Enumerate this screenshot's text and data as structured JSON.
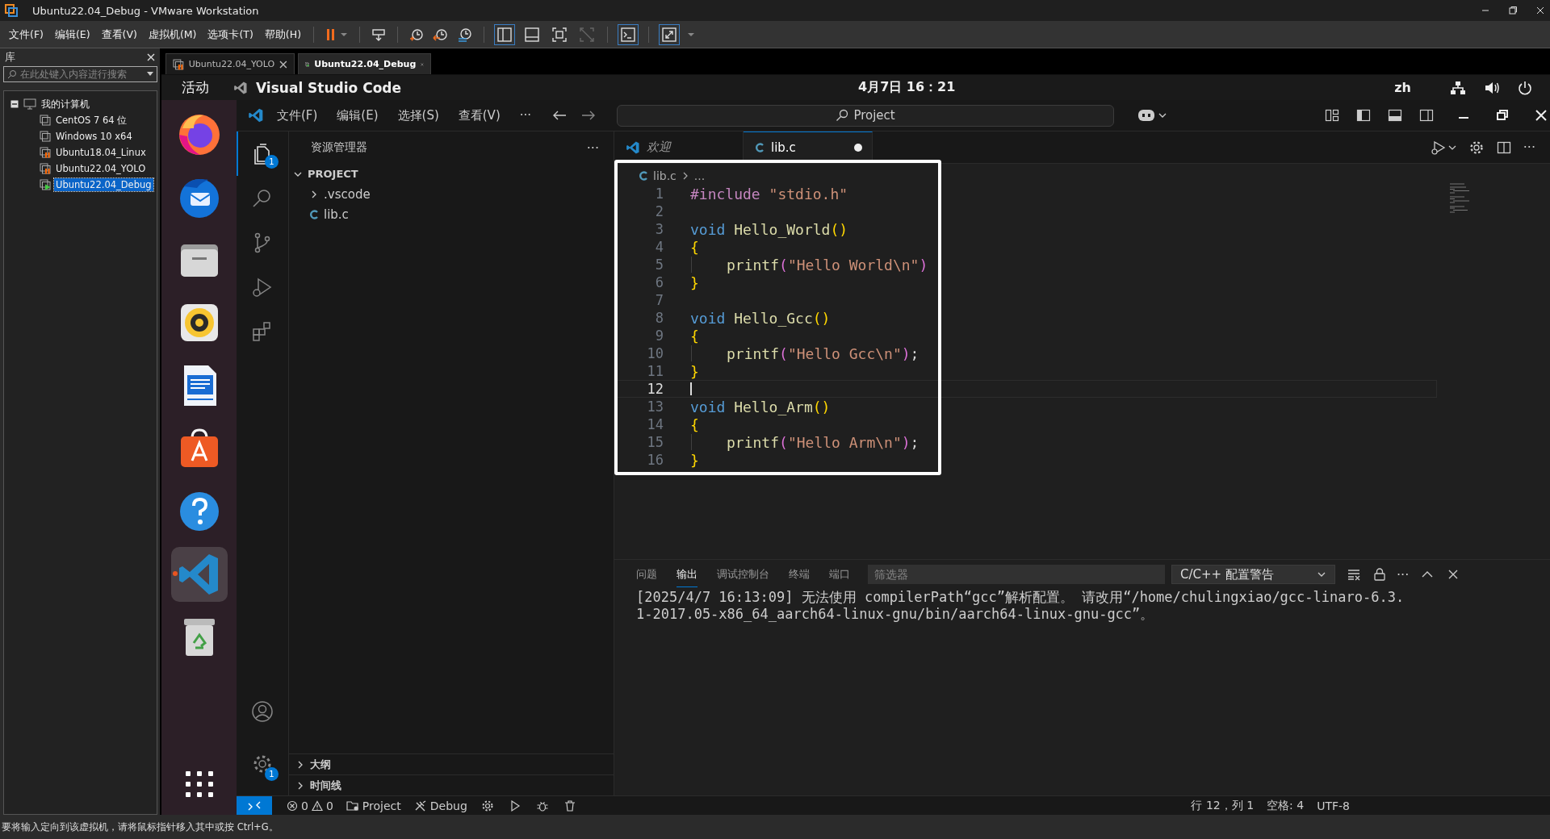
{
  "window": {
    "title": "Ubuntu22.04_Debug - VMware Workstation"
  },
  "menu": [
    "文件(F)",
    "编辑(E)",
    "查看(V)",
    "虚拟机(M)",
    "选项卡(T)",
    "帮助(H)"
  ],
  "library": {
    "title": "库",
    "search": {
      "placeholder": "在此处键入内容进行搜索"
    },
    "root": {
      "label": "我的计算机",
      "expanded": true,
      "children": [
        {
          "label": "CentOS 7 64 位",
          "kind": "off",
          "selected": false
        },
        {
          "label": "Windows 10 x64",
          "kind": "off",
          "selected": false
        },
        {
          "label": "Ubuntu18.04_Linux",
          "kind": "paused",
          "selected": false
        },
        {
          "label": "Ubuntu22.04_YOLO",
          "kind": "paused",
          "selected": false
        },
        {
          "label": "Ubuntu22.04_Debug",
          "kind": "running",
          "selected": true
        }
      ]
    }
  },
  "vm_tabs": [
    {
      "label": "Ubuntu22.04_YOLO",
      "kind": "paused",
      "selected": false
    },
    {
      "label": "Ubuntu22.04_Debug",
      "kind": "running",
      "selected": true
    }
  ],
  "guest_top_bar": {
    "activities": "活动",
    "app": "Visual Studio Code",
    "clock": "4月7日  16：21",
    "input_method": "zh"
  },
  "dock": [
    {
      "kind": "firefox",
      "selected": false
    },
    {
      "kind": "thunderbird",
      "selected": false
    },
    {
      "kind": "files",
      "selected": false
    },
    {
      "kind": "rhythmbox",
      "selected": false
    },
    {
      "kind": "writer",
      "selected": false
    },
    {
      "kind": "appcenter",
      "selected": false
    },
    {
      "kind": "help",
      "selected": false
    },
    {
      "kind": "vscode",
      "selected": true
    },
    {
      "kind": "trash",
      "selected": false
    }
  ],
  "vscode": {
    "menu": [
      "文件(F)",
      "编辑(E)",
      "选择(S)",
      "查看(V)",
      "···"
    ],
    "command_center": "Project",
    "activity_bar": [
      {
        "kind": "explorer",
        "selected": true,
        "badge": "1"
      },
      {
        "kind": "search",
        "selected": false
      },
      {
        "kind": "scm",
        "selected": false
      },
      {
        "kind": "debug",
        "selected": false
      },
      {
        "kind": "extensions",
        "selected": false
      }
    ],
    "manage_badge": "1",
    "sidebar": {
      "title": "资源管理器",
      "more": "···",
      "section": {
        "title": "PROJECT",
        "expanded": true,
        "items": [
          {
            "label": ".vscode",
            "kind": "folder",
            "expanded": false
          },
          {
            "label": "lib.c",
            "kind": "c"
          }
        ]
      },
      "collapsed_sections": [
        {
          "title": "大纲",
          "expanded": false
        },
        {
          "title": "时间线",
          "expanded": false
        }
      ]
    },
    "editor": {
      "tabs": [
        {
          "label": "欢迎",
          "kind": "welcome",
          "selected": false,
          "modified": false
        },
        {
          "label": "lib.c",
          "kind": "c",
          "selected": true,
          "modified": true
        }
      ],
      "breadcrumb": [
        "lib.c",
        "..."
      ],
      "lines": [
        {
          "n": "1",
          "current": false,
          "indent": false,
          "tokens": [
            {
              "t": "#include",
              "kind": "pre"
            },
            {
              "t": " \"stdio.h\"",
              "kind": "str"
            }
          ]
        },
        {
          "n": "2",
          "current": false,
          "indent": false
        },
        {
          "n": "3",
          "current": false,
          "indent": false,
          "tokens": [
            {
              "t": "void",
              "kind": "kw"
            },
            {
              "t": " Hello_World",
              "kind": "fn"
            },
            {
              "t": "()",
              "kind": "p1"
            }
          ]
        },
        {
          "n": "4",
          "current": false,
          "indent": false,
          "tokens": [
            {
              "t": "{",
              "kind": "p1"
            }
          ]
        },
        {
          "n": "5",
          "current": false,
          "indent": true,
          "tokens": [
            {
              "t": "printf",
              "kind": "fn"
            },
            {
              "t": "(",
              "kind": "p2"
            },
            {
              "t": "\"Hello World\\n\"",
              "kind": "str"
            },
            {
              "t": ")",
              "kind": "p2"
            }
          ]
        },
        {
          "n": "6",
          "current": false,
          "indent": false,
          "tokens": [
            {
              "t": "}",
              "kind": "p1"
            }
          ]
        },
        {
          "n": "7",
          "current": false,
          "indent": false
        },
        {
          "n": "8",
          "current": false,
          "indent": false,
          "tokens": [
            {
              "t": "void",
              "kind": "kw"
            },
            {
              "t": " Hello_Gcc",
              "kind": "fn"
            },
            {
              "t": "()",
              "kind": "p1"
            }
          ]
        },
        {
          "n": "9",
          "current": false,
          "indent": false,
          "tokens": [
            {
              "t": "{",
              "kind": "p1"
            }
          ]
        },
        {
          "n": "10",
          "current": false,
          "indent": true,
          "tokens": [
            {
              "t": "printf",
              "kind": "fn"
            },
            {
              "t": "(",
              "kind": "p2"
            },
            {
              "t": "\"Hello Gcc\\n\"",
              "kind": "str"
            },
            {
              "t": ")",
              "kind": "p2"
            },
            {
              "t": ";",
              "kind": "punct"
            }
          ]
        },
        {
          "n": "11",
          "current": false,
          "indent": false,
          "tokens": [
            {
              "t": "}",
              "kind": "p1"
            }
          ]
        },
        {
          "n": "12",
          "current": true,
          "indent": false
        },
        {
          "n": "13",
          "current": false,
          "indent": false,
          "tokens": [
            {
              "t": "void",
              "kind": "kw"
            },
            {
              "t": " Hello_Arm",
              "kind": "fn"
            },
            {
              "t": "()",
              "kind": "p1"
            }
          ]
        },
        {
          "n": "14",
          "current": false,
          "indent": false,
          "tokens": [
            {
              "t": "{",
              "kind": "p1"
            }
          ]
        },
        {
          "n": "15",
          "current": false,
          "indent": true,
          "tokens": [
            {
              "t": "printf",
              "kind": "fn"
            },
            {
              "t": "(",
              "kind": "p2"
            },
            {
              "t": "\"Hello Arm\\n\"",
              "kind": "str"
            },
            {
              "t": ")",
              "kind": "p2"
            },
            {
              "t": ";",
              "kind": "punct"
            }
          ]
        },
        {
          "n": "16",
          "current": false,
          "indent": false,
          "tokens": [
            {
              "t": "}",
              "kind": "p1"
            }
          ]
        }
      ]
    },
    "panel": {
      "tabs": [
        {
          "label": "问题",
          "selected": false
        },
        {
          "label": "输出",
          "selected": true
        },
        {
          "label": "调试控制台",
          "selected": false
        },
        {
          "label": "终端",
          "selected": false
        },
        {
          "label": "端口",
          "selected": false
        }
      ],
      "filter": {
        "placeholder": "筛选器"
      },
      "channel": "C/C++ 配置警告",
      "output": [
        "[2025/4/7 16:13:09] 无法使用 compilerPath“gcc”解析配置。 请改用“/home/chulingxiao/gcc-linaro-6.3.",
        "1-2017.05-x86_64_aarch64-linux-gnu/bin/aarch64-linux-gnu-gcc”。"
      ]
    },
    "status_bar": {
      "problems": [
        {
          "kind": "error",
          "count": "0"
        },
        {
          "kind": "warning",
          "count": "0"
        }
      ],
      "items": [
        {
          "kind": "folder",
          "label": "Project"
        },
        {
          "kind": "build",
          "label": "Debug"
        }
      ],
      "right": [
        "行 12，列 1",
        "空格: 4",
        "UTF-8"
      ]
    }
  },
  "vm_status": "要将输入定向到该虚拟机，请将鼠标指针移入其中或按 Ctrl+G。"
}
